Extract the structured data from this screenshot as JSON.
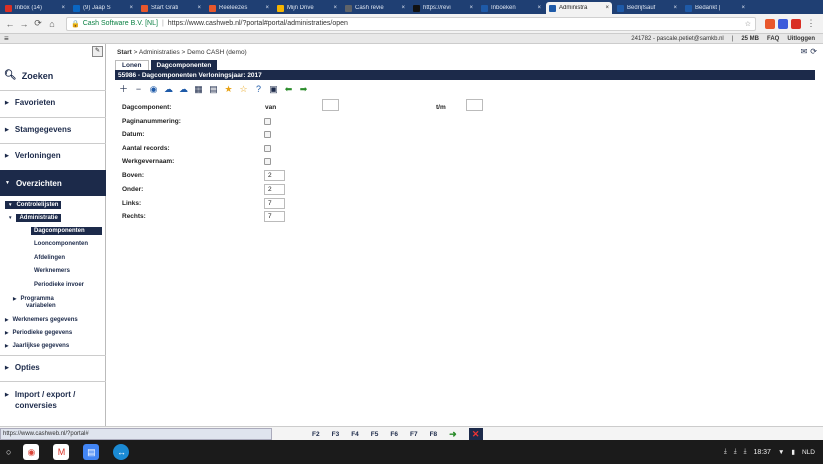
{
  "browser": {
    "tabs": [
      {
        "title": "Inbox (14)",
        "color": "#d93025",
        "active": false
      },
      {
        "title": "(9) Jaap S",
        "color": "#0a66c2",
        "active": false
      },
      {
        "title": "Start Grati",
        "color": "#e8572c",
        "active": false
      },
      {
        "title": "Reeleezes",
        "color": "#e8572c",
        "active": false
      },
      {
        "title": "Mijn Drive",
        "color": "#f4b400",
        "active": false
      },
      {
        "title": "Cash revie",
        "color": "#5f6368",
        "active": false
      },
      {
        "title": "https://revi",
        "color": "#111111",
        "active": false
      },
      {
        "title": "Inboeken",
        "color": "#1e5aa8",
        "active": false
      },
      {
        "title": "Administra",
        "color": "#1e5aa8",
        "active": true
      },
      {
        "title": "Bedrijfsauf",
        "color": "#1e5aa8",
        "active": false
      },
      {
        "title": "Bedankt |",
        "color": "#1e5aa8",
        "active": false
      }
    ],
    "site_name": "Cash Software B.V. [NL]",
    "url": "https://www.cashweb.nl/?portal#portal/administraties/open"
  },
  "appbar": {
    "menu_glyph": "≡",
    "user": "241782 - pascale.petiet@samkb.nl",
    "sep1": "|",
    "storage": "25 MB",
    "faq": "FAQ",
    "logout": "Uitloggen"
  },
  "sidebar": {
    "search": "Zoeken",
    "sections": {
      "favorieten": "Favorieten",
      "stamgegevens": "Stamgegevens",
      "verloningen": "Verloningen",
      "overzichten": "Overzichten",
      "opties": "Opties",
      "import_export_1": "Import / export /",
      "import_export_2": "conversies"
    },
    "tree": {
      "controlelijsten": "Controlelijsten",
      "administratie": "Administratie",
      "dagcomponenten": "Dagcomponenten",
      "looncomponenten": "Looncomponenten",
      "afdelingen": "Afdelingen",
      "werknemers": "Werknemers",
      "periodieke_invoer": "Periodieke invoer",
      "programma_1": "Programma",
      "programma_2": "variabelen",
      "werknemers_gegevens": "Werknemers gegevens",
      "periodieke_gegevens": "Periodieke gegevens",
      "jaarlijkse_gegevens": "Jaarlijkse gegevens"
    }
  },
  "content": {
    "breadcrumb": {
      "start": "Start",
      "sep": ">",
      "admin": "Administraties",
      "demo": "Demo CASH (demo)"
    },
    "tabs": {
      "lonen": "Lonen",
      "dagcomponenten": "Dagcomponenten"
    },
    "title": "55986 - Dagcomponenten Verloningsjaar: 2017",
    "form": {
      "dagcomponent": "Dagcomponent:",
      "van": "van",
      "tm": "t/m",
      "paginanummering": "Paginanummering:",
      "datum": "Datum:",
      "aantal_records": "Aantal records:",
      "werkgevernaam": "Werkgevernaam:",
      "boven": "Boven:",
      "boven_val": "2",
      "onder": "Onder:",
      "onder_val": "2",
      "links": "Links:",
      "links_val": "7",
      "rechts": "Rechts:",
      "rechts_val": "7"
    }
  },
  "statusbar": {
    "url": "https://www.cashweb.nl/?portal#",
    "fkeys": [
      "F2",
      "F3",
      "F4",
      "F5",
      "F6",
      "F7",
      "F8"
    ]
  },
  "taskbar": {
    "time": "18:37",
    "lang": "NLD"
  }
}
